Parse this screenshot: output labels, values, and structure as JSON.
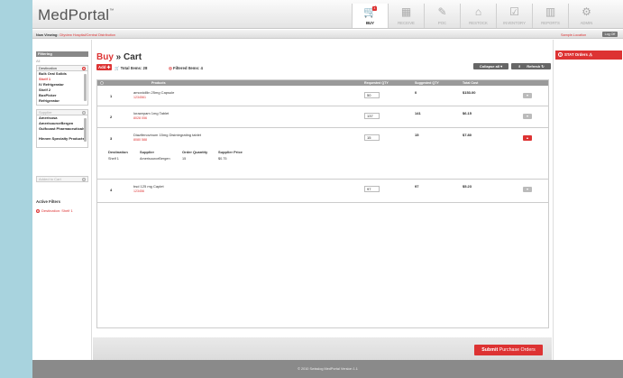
{
  "app": {
    "name": "MedPortal",
    "tm": "™"
  },
  "nav": [
    {
      "label": "BUY",
      "icon": "cart-icon",
      "active": true,
      "badge": "4"
    },
    {
      "label": "RECEIVE",
      "icon": "receive-icon",
      "active": false
    },
    {
      "label": "POC",
      "icon": "poc-icon",
      "active": false
    },
    {
      "label": "RESTOCK",
      "icon": "restock-icon",
      "active": false
    },
    {
      "label": "INVENTORY",
      "icon": "inventory-icon",
      "active": false
    },
    {
      "label": "REPORTS",
      "icon": "reports-icon",
      "active": false
    },
    {
      "label": "ADMIN",
      "icon": "gear-icon",
      "active": false
    }
  ],
  "subbar": {
    "viewing_label": "Now Viewing:",
    "viewing_value": "Cityview Hospital/Central Distribution",
    "user": "Sample.Location",
    "logoff": "Log Off"
  },
  "filters": {
    "heading": "Filtering",
    "all": "All",
    "destination_label": "Destination",
    "destination_items": [
      "Bulk Oral Solids",
      "Shelf 1",
      "IV Refrigerator",
      "Shelf 2",
      "BoxPicker",
      "Refrigerator"
    ],
    "destination_selected": "Shelf 1",
    "supplier_label": "Supplier",
    "supplier_items": [
      "Amerisosa",
      "AmerisourceBergen",
      "Gulfcoast Pharmaceuticals",
      "Hinnen Specialty Products"
    ],
    "added_label": "Added to Cart",
    "active_heading": "Active Filters",
    "active_item": "Destination: Shelf 1"
  },
  "main": {
    "title_buy": "Buy",
    "title_sep": " » ",
    "title_cart": "Cart",
    "add_label": "Add",
    "total_items": "Total Items: 28",
    "filtered_items": "Filtered Items: 4",
    "collapse_all": "Collapse all",
    "expand_all": "Expand all",
    "refresh": "Refresh",
    "columns": {
      "products": "Products",
      "requested": "Requested QTY",
      "suggested": "Suggested QTY",
      "total_cost": "Total Cost"
    },
    "rows": [
      {
        "num": "1",
        "name": "amoxicillin 25mg Capsule",
        "id": "1234561",
        "qty": "50",
        "suggested": "0",
        "cost": "$153.00",
        "expanded": false
      },
      {
        "num": "2",
        "name": "lorazepam 1mg Tablet",
        "id": "8028 056",
        "qty": "137",
        "suggested": "141",
        "cost": "$6.15",
        "expanded": false
      },
      {
        "num": "3",
        "name": "Diazifenovinum 15mg Disintegrating tablet",
        "id": "8080 588",
        "qty": "15",
        "suggested": "15",
        "cost": "$7.80",
        "expanded": true,
        "detail": {
          "h_destination": "Destination",
          "h_supplier": "Supplier",
          "h_order_qty": "Order Quantity",
          "h_price": "Supplier Price",
          "destination": "Shelf 1",
          "supplier": "AmerisourceBergen",
          "order_qty": "15",
          "price": "$0.75"
        }
      },
      {
        "num": "4",
        "name": "bsd 125 mg Caplet",
        "id": "123456",
        "qty": "97",
        "suggested": "97",
        "cost": "$5.23",
        "expanded": false
      }
    ],
    "submit_bold": "Submit",
    "submit_rest": " Purchase Orders"
  },
  "right": {
    "stat_label": "STAT Orders"
  },
  "footer": {
    "text": "© 2010 Swisslog  MedPortal Version 1.1"
  },
  "colors": {
    "accent": "#dd3333",
    "background": "#a8d3de",
    "footer": "#8a8a8a"
  }
}
